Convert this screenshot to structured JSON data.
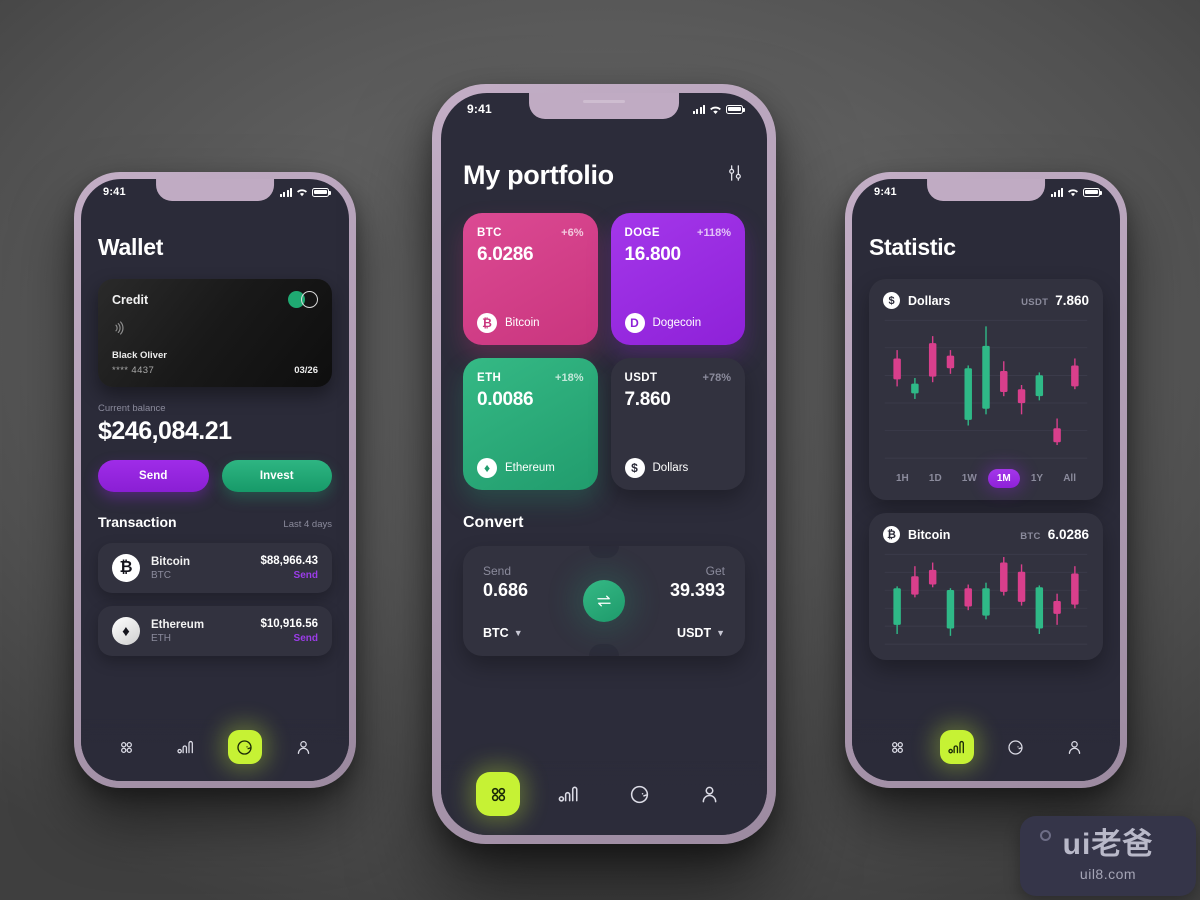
{
  "status_bar": {
    "time": "9:41"
  },
  "wallet": {
    "title": "Wallet",
    "card": {
      "label": "Credit",
      "holder": "Black Oliver",
      "number": "**** 4437",
      "expiry": "03/26"
    },
    "balance_label": "Current balance",
    "balance_value": "$246,084.21",
    "actions": {
      "send": "Send",
      "invest": "Invest"
    },
    "transactions_title": "Transaction",
    "transactions_sub": "Last 4 days",
    "transactions": [
      {
        "name": "Bitcoin",
        "ticker": "BTC",
        "amount": "$88,966.43",
        "action": "Send",
        "glyph": "₿"
      },
      {
        "name": "Ethereum",
        "ticker": "ETH",
        "amount": "$10,916.56",
        "action": "Send",
        "glyph": "♦"
      }
    ],
    "nav": [
      {
        "name": "grid",
        "active": false
      },
      {
        "name": "stats",
        "active": false
      },
      {
        "name": "convert",
        "active": true
      },
      {
        "name": "profile",
        "active": false
      }
    ]
  },
  "portfolio": {
    "title": "My portfolio",
    "filter_icon": "sliders-icon",
    "cards": [
      {
        "symbol": "BTC",
        "change": "+6%",
        "value": "6.0286",
        "name": "Bitcoin",
        "glyph": "₿",
        "theme": "btc"
      },
      {
        "symbol": "DOGE",
        "change": "+118%",
        "value": "16.800",
        "name": "Dogecoin",
        "glyph": "D",
        "theme": "doge"
      },
      {
        "symbol": "ETH",
        "change": "+18%",
        "value": "0.0086",
        "name": "Ethereum",
        "glyph": "♦",
        "theme": "eth"
      },
      {
        "symbol": "USDT",
        "change": "+78%",
        "value": "7.860",
        "name": "Dollars",
        "glyph": "$",
        "theme": "usdt"
      }
    ],
    "convert": {
      "title": "Convert",
      "send_label": "Send",
      "send_value": "0.686",
      "send_currency": "BTC",
      "get_label": "Get",
      "get_value": "39.393",
      "get_currency": "USDT",
      "swap_icon": "swap-arrows-icon"
    },
    "nav": [
      {
        "name": "grid",
        "active": true
      },
      {
        "name": "stats",
        "active": false
      },
      {
        "name": "convert",
        "active": false
      },
      {
        "name": "profile",
        "active": false
      }
    ]
  },
  "statistic": {
    "title": "Statistic",
    "cards": [
      {
        "name": "Dollars",
        "glyph": "$",
        "ticker": "USDT",
        "value": "7.860"
      },
      {
        "name": "Bitcoin",
        "glyph": "₿",
        "ticker": "BTC",
        "value": "6.0286"
      }
    ],
    "ranges": [
      {
        "label": "1H",
        "active": false
      },
      {
        "label": "1D",
        "active": false
      },
      {
        "label": "1W",
        "active": false
      },
      {
        "label": "1M",
        "active": true
      },
      {
        "label": "1Y",
        "active": false
      },
      {
        "label": "All",
        "active": false
      }
    ],
    "nav": [
      {
        "name": "grid",
        "active": false
      },
      {
        "name": "stats",
        "active": true
      },
      {
        "name": "convert",
        "active": false
      },
      {
        "name": "profile",
        "active": false
      }
    ]
  },
  "chart_data": [
    {
      "type": "candlestick",
      "title": "Dollars",
      "ticker": "USDT",
      "last_value": 7.86,
      "range": "1M",
      "grid": true,
      "ylim": [
        0,
        100
      ],
      "colors": {
        "up": "#2fb987",
        "down": "#d93f8c"
      },
      "candles": [
        {
          "open": 72,
          "close": 57,
          "high": 78,
          "low": 52,
          "dir": "down"
        },
        {
          "open": 47,
          "close": 54,
          "high": 58,
          "low": 43,
          "dir": "up"
        },
        {
          "open": 83,
          "close": 59,
          "high": 88,
          "low": 55,
          "dir": "down"
        },
        {
          "open": 74,
          "close": 65,
          "high": 78,
          "low": 61,
          "dir": "down"
        },
        {
          "open": 65,
          "close": 28,
          "high": 67,
          "low": 24,
          "dir": "up"
        },
        {
          "open": 36,
          "close": 81,
          "high": 95,
          "low": 32,
          "dir": "up"
        },
        {
          "open": 63,
          "close": 48,
          "high": 70,
          "low": 45,
          "dir": "down"
        },
        {
          "open": 50,
          "close": 40,
          "high": 53,
          "low": 32,
          "dir": "down"
        },
        {
          "open": 60,
          "close": 45,
          "high": 62,
          "low": 42,
          "dir": "up"
        },
        {
          "open": 22,
          "close": 12,
          "high": 29,
          "low": 10,
          "dir": "down"
        },
        {
          "open": 67,
          "close": 52,
          "high": 72,
          "low": 50,
          "dir": "down"
        }
      ]
    },
    {
      "type": "candlestick",
      "title": "Bitcoin",
      "ticker": "BTC",
      "last_value": 6.0286,
      "grid": true,
      "ylim": [
        0,
        100
      ],
      "colors": {
        "up": "#2fb987",
        "down": "#d93f8c"
      },
      "candles": [
        {
          "open": 62,
          "close": 22,
          "high": 64,
          "low": 12,
          "dir": "up"
        },
        {
          "open": 75,
          "close": 55,
          "high": 86,
          "low": 52,
          "dir": "down"
        },
        {
          "open": 82,
          "close": 66,
          "high": 90,
          "low": 63,
          "dir": "down"
        },
        {
          "open": 60,
          "close": 18,
          "high": 62,
          "low": 10,
          "dir": "up"
        },
        {
          "open": 62,
          "close": 42,
          "high": 66,
          "low": 38,
          "dir": "down"
        },
        {
          "open": 62,
          "close": 32,
          "high": 68,
          "low": 28,
          "dir": "up"
        },
        {
          "open": 90,
          "close": 58,
          "high": 96,
          "low": 54,
          "dir": "down"
        },
        {
          "open": 80,
          "close": 47,
          "high": 88,
          "low": 43,
          "dir": "down"
        },
        {
          "open": 63,
          "close": 18,
          "high": 65,
          "low": 12,
          "dir": "up"
        },
        {
          "open": 48,
          "close": 34,
          "high": 56,
          "low": 22,
          "dir": "down"
        },
        {
          "open": 78,
          "close": 44,
          "high": 86,
          "low": 40,
          "dir": "down"
        }
      ]
    }
  ],
  "watermark": {
    "main": "ui老爸",
    "sub": "uil8.com"
  }
}
